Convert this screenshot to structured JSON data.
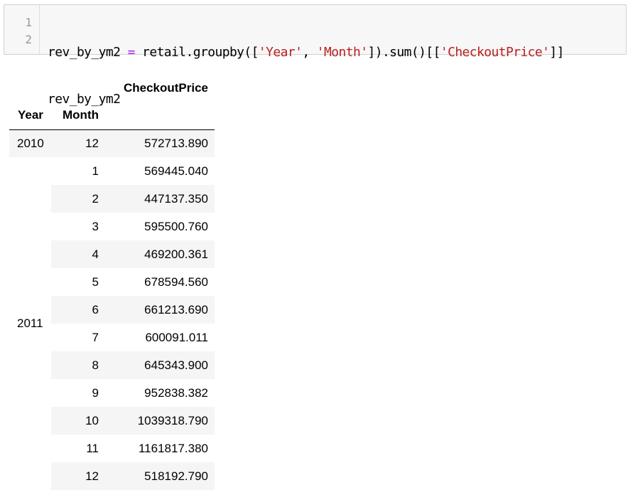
{
  "code_cell": {
    "line_numbers": [
      "1",
      "2"
    ],
    "line1": {
      "var": "rev_by_ym2 ",
      "eq": "=",
      "call1": " retail.groupby([",
      "s1": "'Year'",
      "comma": ", ",
      "s2": "'Month'",
      "call2": "]).sum()[[",
      "s3": "'CheckoutPrice'",
      "end": "]]"
    },
    "line2": "rev_by_ym2"
  },
  "dataframe": {
    "column_header": "CheckoutPrice",
    "index_names": [
      "Year",
      "Month"
    ],
    "groups": [
      {
        "year": "2010",
        "rows": [
          {
            "month": "12",
            "checkout_price": "572713.890"
          }
        ]
      },
      {
        "year": "2011",
        "rows": [
          {
            "month": "1",
            "checkout_price": "569445.040"
          },
          {
            "month": "2",
            "checkout_price": "447137.350"
          },
          {
            "month": "3",
            "checkout_price": "595500.760"
          },
          {
            "month": "4",
            "checkout_price": "469200.361"
          },
          {
            "month": "5",
            "checkout_price": "678594.560"
          },
          {
            "month": "6",
            "checkout_price": "661213.690"
          },
          {
            "month": "7",
            "checkout_price": "600091.011"
          },
          {
            "month": "8",
            "checkout_price": "645343.900"
          },
          {
            "month": "9",
            "checkout_price": "952838.382"
          },
          {
            "month": "10",
            "checkout_price": "1039318.790"
          },
          {
            "month": "11",
            "checkout_price": "1161817.380"
          },
          {
            "month": "12",
            "checkout_price": "518192.790"
          }
        ]
      }
    ]
  }
}
